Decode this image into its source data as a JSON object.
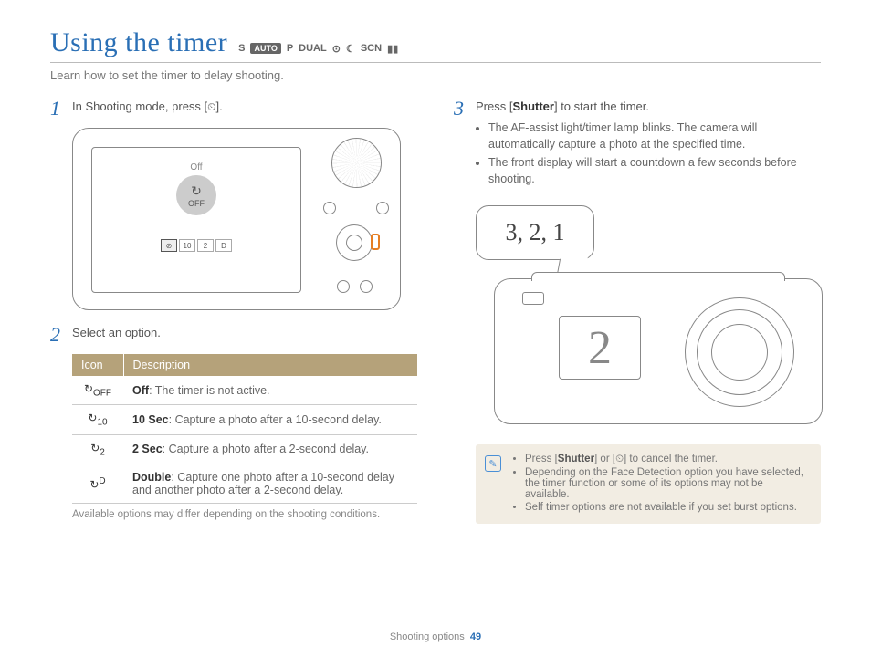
{
  "title": "Using the timer",
  "mode_icons": {
    "smart": "S",
    "auto": "AUTO",
    "program": "P",
    "dual": "DUAL",
    "beauty": "⊙",
    "night": "☾",
    "scene": "SCN",
    "movie": "▮▮"
  },
  "intro": "Learn how to set the timer to delay shooting.",
  "step1": {
    "num": "1",
    "text_pre": "In Shooting mode, press [",
    "text_post": "]."
  },
  "screen": {
    "off_label": "Off",
    "off_icon": "OFF"
  },
  "step2": {
    "num": "2",
    "text": "Select an option."
  },
  "table": {
    "h_icon": "Icon",
    "h_desc": "Description",
    "rows": [
      {
        "icon": "OFF",
        "label": "Off",
        "desc": ": The timer is not active."
      },
      {
        "icon": "10",
        "label": "10 Sec",
        "desc": ": Capture a photo after a 10-second delay."
      },
      {
        "icon": "2",
        "label": "2 Sec",
        "desc": ": Capture a photo after a 2-second delay."
      },
      {
        "icon": "D",
        "label": "Double",
        "desc": ": Capture one photo after a 10-second delay and another photo after a 2-second delay."
      }
    ]
  },
  "footnote": "Available options may differ depending on the shooting conditions.",
  "step3": {
    "num": "3",
    "text_pre": "Press [",
    "shutter": "Shutter",
    "text_post": "] to start the timer.",
    "bullets": [
      "The AF-assist light/timer lamp blinks. The camera will automatically capture a photo at the specified time.",
      "The front display will start a countdown a few seconds before shooting."
    ]
  },
  "bubble": "3, 2, 1",
  "front_display": "2",
  "note": {
    "items": [
      {
        "pre": "Press [",
        "b1": "Shutter",
        "mid": "] or [",
        "icon": "⏲",
        "post": "] to cancel the timer."
      },
      {
        "text": "Depending on the Face Detection option you have selected, the timer function or some of its options may not be available."
      },
      {
        "text": "Self timer options are not available if you set burst options."
      }
    ]
  },
  "footer": {
    "section": "Shooting options",
    "page": "49"
  }
}
